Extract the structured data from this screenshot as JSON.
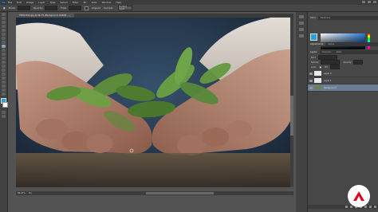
{
  "app": {
    "logo_text": "Ps"
  },
  "menu": [
    "File",
    "Edit",
    "Image",
    "Layer",
    "Type",
    "Select",
    "Filter",
    "3D",
    "View",
    "Window",
    "Help"
  ],
  "options_bar": {
    "mode_label": "Mode:",
    "opacity_label": "Opacity:",
    "flow_label": "Flow:",
    "aligned_label": "Aligned",
    "sample_label": "Sample:",
    "sample_value": "Current Layer"
  },
  "document": {
    "tab_title": "TPDM7819.jpg @ 66.7% (Background, RGB/8)",
    "close_glyph": "×"
  },
  "statusbar": {
    "zoom": "66.67%",
    "doc_size": "Doc: 8.90M/8.90M"
  },
  "panels": {
    "color_tabs": [
      "Color",
      "Swatches"
    ],
    "adjust_tabs": [
      "Adjustments",
      "Styles"
    ],
    "layers_tabs": [
      "Layers",
      "Channels",
      "Paths"
    ],
    "layers_controls": {
      "kind": "Kind",
      "blend": "Normal",
      "opacity_label": "Opacity:",
      "lock_label": "Lock:",
      "fill_label": "Fill:"
    },
    "layers": [
      {
        "name": "Layer 2",
        "selected": false
      },
      {
        "name": "Layer 1",
        "selected": false
      },
      {
        "name": "Background",
        "selected": true
      }
    ]
  },
  "colors": {
    "foreground": "#27a2d9",
    "background": "#ffffff",
    "brand": "#e2001a"
  },
  "icons": {
    "app_logo": "photoshop-icon",
    "brand_logo": "brand-logo-icon"
  }
}
